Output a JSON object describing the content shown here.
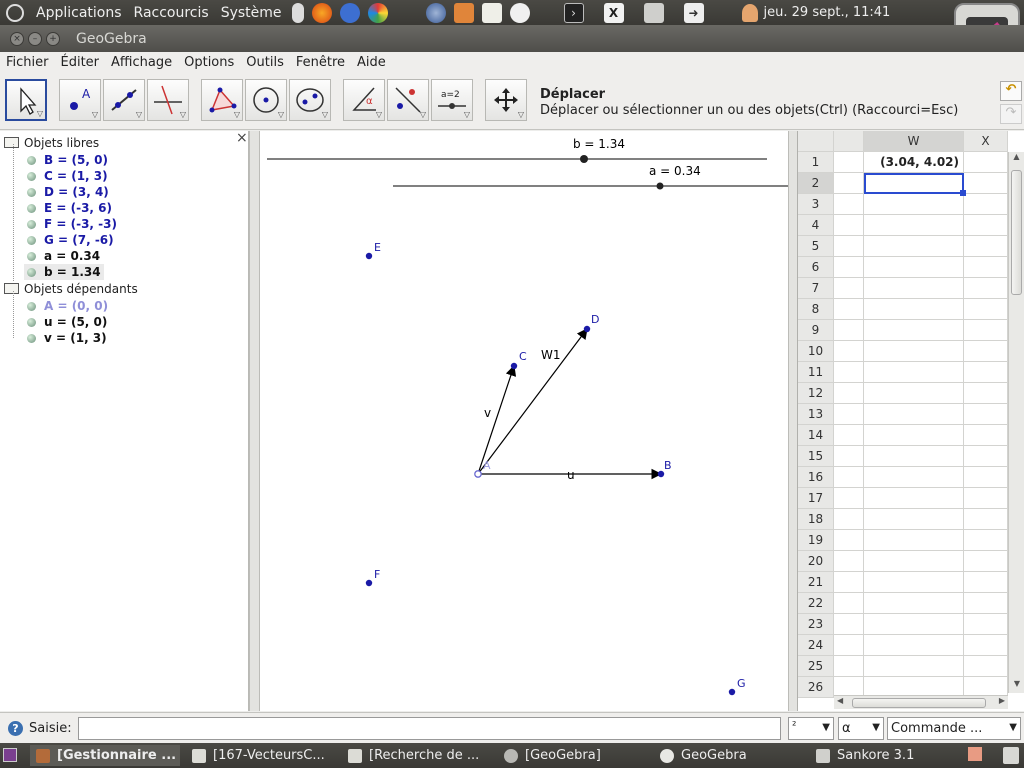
{
  "top_panel": {
    "menus": [
      "Applications",
      "Raccourcis",
      "Système"
    ],
    "clock": "jeu. 29 sept., 11:41"
  },
  "window": {
    "title": "GeoGebra"
  },
  "menubar": [
    "Fichier",
    "Éditer",
    "Affichage",
    "Options",
    "Outils",
    "Fenêtre",
    "Aide"
  ],
  "tool_info": {
    "name": "Déplacer",
    "description": "Déplacer ou sélectionner un ou des objets(Ctrl) (Raccourci=Esc)"
  },
  "tools": {
    "point_label": "A",
    "angle_label": "α",
    "slider_label": "a=2"
  },
  "algebra": {
    "free_header": "Objets libres",
    "free": [
      "B = (5, 0)",
      "C = (1, 3)",
      "D = (3, 4)",
      "E = (-3, 6)",
      "F = (-3, -3)",
      "G = (7, -6)",
      "a = 0.34",
      "b = 1.34"
    ],
    "dependent_header": "Objets dépendants",
    "dependent": [
      "A = (0, 0)",
      "u = (5, 0)",
      "v = (1, 3)"
    ],
    "close": "×"
  },
  "graphics": {
    "slider_b": "b = 1.34",
    "slider_a": "a = 0.34",
    "labels": {
      "A": "A",
      "B": "B",
      "C": "C",
      "D": "D",
      "E": "E",
      "F": "F",
      "G": "G",
      "u": "u",
      "v": "v",
      "W1": "W1"
    },
    "colors": {
      "point": "#1a1aa6",
      "line": "#000000"
    }
  },
  "spreadsheet": {
    "col_w": "W",
    "col_x": "X",
    "rows": [
      "1",
      "2",
      "3",
      "4",
      "5",
      "6",
      "7",
      "8",
      "9",
      "10",
      "11",
      "12",
      "13",
      "14",
      "15",
      "16",
      "17",
      "18",
      "19",
      "20",
      "21",
      "22",
      "23",
      "24",
      "25",
      "26"
    ],
    "w1": "(3.04, 4.02)"
  },
  "input": {
    "label": "Saisie:",
    "value": "",
    "exponent": "²",
    "greek": "α",
    "command": "Commande ..."
  },
  "taskbar": [
    "[Gestionnaire ...",
    "[167-VecteursC...",
    "[Recherche de ...",
    "[GeoGebra]",
    "GeoGebra",
    "Sankore 3.1"
  ]
}
